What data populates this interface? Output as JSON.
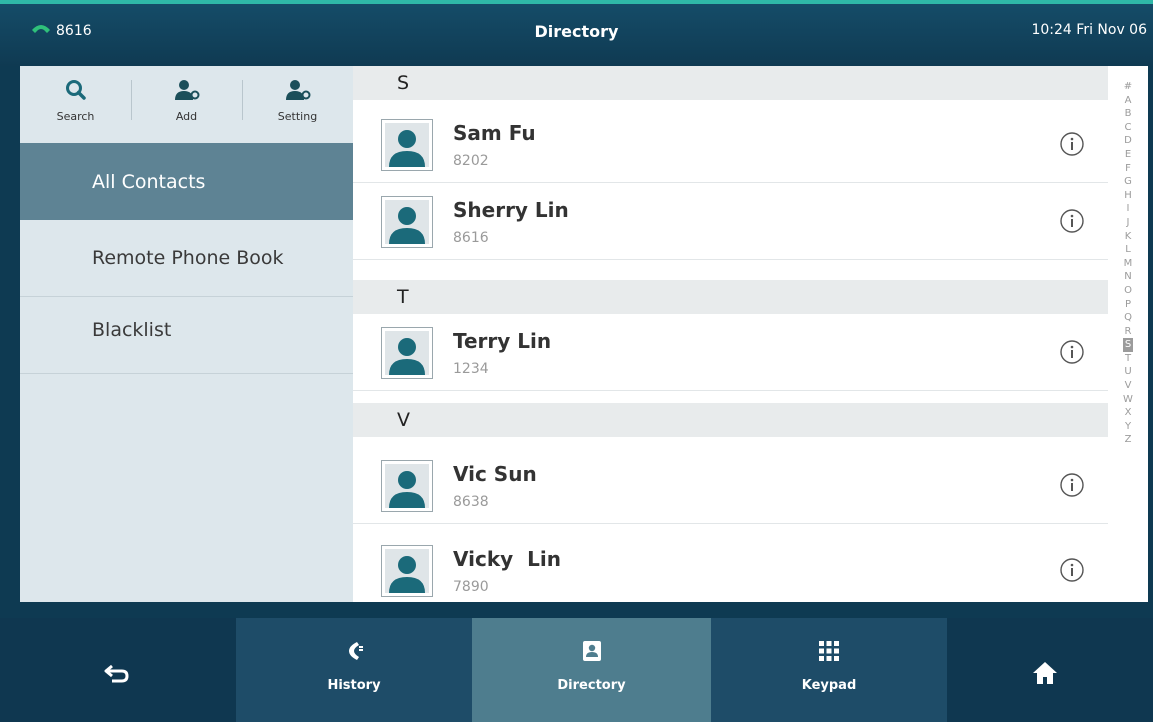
{
  "status": {
    "extension": "8616",
    "title": "Directory",
    "time": "10:24 Fri Nov 06"
  },
  "toolbar": {
    "search_label": "Search",
    "add_label": "Add",
    "setting_label": "Setting"
  },
  "sidebar": {
    "items": [
      {
        "label": "All Contacts",
        "active": true
      },
      {
        "label": "Remote Phone Book",
        "active": false
      },
      {
        "label": "Blacklist",
        "active": false
      }
    ]
  },
  "sections": [
    {
      "letter": "S",
      "contacts": [
        {
          "name": "Sam Fu",
          "number": "8202"
        },
        {
          "name": "Sherry Lin",
          "number": "8616"
        }
      ]
    },
    {
      "letter": "T",
      "contacts": [
        {
          "name": "Terry Lin",
          "number": "1234"
        }
      ]
    },
    {
      "letter": "V",
      "contacts": [
        {
          "name": "Vic Sun",
          "number": "8638"
        },
        {
          "name": "Vicky  Lin",
          "number": "7890"
        }
      ]
    }
  ],
  "alphabet": [
    "#",
    "A",
    "B",
    "C",
    "D",
    "E",
    "F",
    "G",
    "H",
    "I",
    "J",
    "K",
    "L",
    "M",
    "N",
    "O",
    "P",
    "Q",
    "R",
    "S",
    "T",
    "U",
    "V",
    "W",
    "X",
    "Y",
    "Z"
  ],
  "alphabet_selected": "S",
  "bottom_tabs": {
    "history": "History",
    "directory": "Directory",
    "keypad": "Keypad"
  },
  "colors": {
    "accent_green": "#2fb8a8",
    "avatar_teal": "#1b6a7a",
    "active_item": "#5e8394"
  }
}
